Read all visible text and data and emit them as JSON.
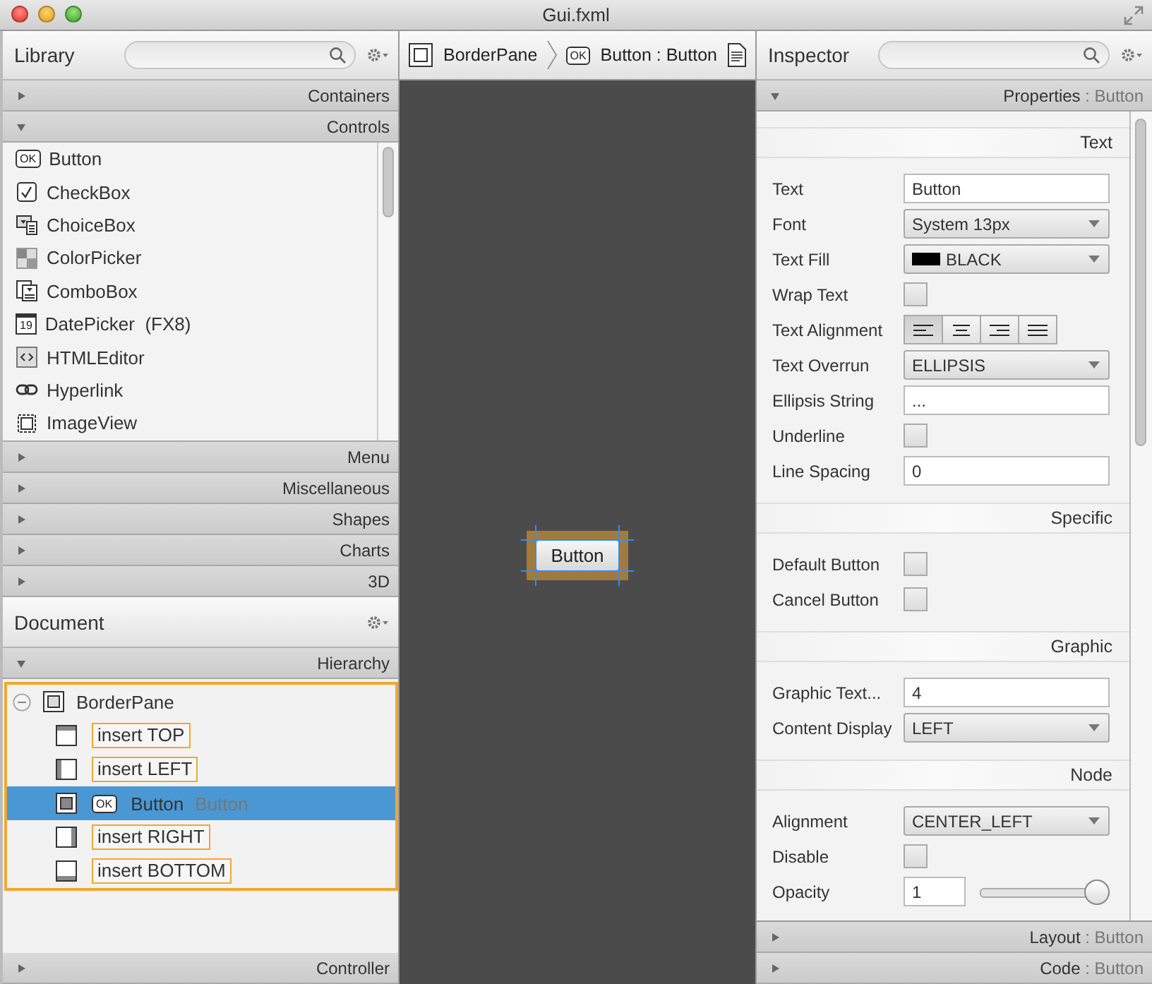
{
  "window": {
    "title": "Gui.fxml"
  },
  "library": {
    "title": "Library",
    "sections": [
      {
        "label": "Containers",
        "expanded": false
      },
      {
        "label": "Controls",
        "expanded": true,
        "items": [
          {
            "label": "Button",
            "badge": "OK"
          },
          {
            "label": "CheckBox"
          },
          {
            "label": "ChoiceBox"
          },
          {
            "label": "ColorPicker"
          },
          {
            "label": "ComboBox"
          },
          {
            "label": "DatePicker  (FX8)",
            "badge": "19"
          },
          {
            "label": "HTMLEditor"
          },
          {
            "label": "Hyperlink"
          },
          {
            "label": "ImageView"
          }
        ]
      },
      {
        "label": "Menu",
        "expanded": false
      },
      {
        "label": "Miscellaneous",
        "expanded": false
      },
      {
        "label": "Shapes",
        "expanded": false
      },
      {
        "label": "Charts",
        "expanded": false
      },
      {
        "label": "3D",
        "expanded": false
      }
    ]
  },
  "document": {
    "title": "Document",
    "sections": [
      {
        "label": "Hierarchy",
        "expanded": true,
        "tree": [
          {
            "label": "BorderPane",
            "expanded": true,
            "children": [
              {
                "kind": "slot",
                "label": "insert TOP",
                "selected": false
              },
              {
                "kind": "slot",
                "label": "insert LEFT",
                "selected": false
              },
              {
                "kind": "node",
                "badge": "OK",
                "label": "Button",
                "type": "Button",
                "selected": true
              },
              {
                "kind": "slot",
                "label": "insert RIGHT",
                "selected": false
              },
              {
                "kind": "slot",
                "label": "insert BOTTOM",
                "selected": false
              }
            ]
          }
        ]
      },
      {
        "label": "Controller",
        "expanded": false
      }
    ]
  },
  "breadcrumb": [
    {
      "label": "BorderPane"
    },
    {
      "label": "Button : Button",
      "badge": "OK"
    }
  ],
  "canvas": {
    "button": {
      "label": "Button",
      "selected": true
    }
  },
  "inspector": {
    "title": "Inspector",
    "sections": [
      {
        "label": "Properties",
        "context": ": Button",
        "expanded": true,
        "groups": [
          {
            "title": "Text",
            "rows": [
              {
                "kind": "text",
                "label": "Text",
                "value": "Button"
              },
              {
                "kind": "select",
                "label": "Font",
                "value": "System 13px"
              },
              {
                "kind": "color",
                "label": "Text Fill",
                "value": "BLACK",
                "color": "#000000"
              },
              {
                "kind": "checkbox",
                "label": "Wrap Text",
                "checked": false
              },
              {
                "kind": "segmented",
                "label": "Text Alignment",
                "options": [
                  {
                    "selected": true
                  },
                  {
                    "selected": false
                  },
                  {
                    "selected": false
                  },
                  {
                    "selected": false
                  }
                ]
              },
              {
                "kind": "select",
                "label": "Text Overrun",
                "value": "ELLIPSIS"
              },
              {
                "kind": "text",
                "label": "Ellipsis String",
                "value": "..."
              },
              {
                "kind": "checkbox",
                "label": "Underline",
                "checked": false
              },
              {
                "kind": "text",
                "label": "Line Spacing",
                "value": "0"
              }
            ]
          },
          {
            "title": "Specific",
            "rows": [
              {
                "kind": "checkbox",
                "label": "Default Button",
                "checked": false
              },
              {
                "kind": "checkbox",
                "label": "Cancel Button",
                "checked": false
              }
            ]
          },
          {
            "title": "Graphic",
            "rows": [
              {
                "kind": "text",
                "label": "Graphic Text...",
                "value": "4"
              },
              {
                "kind": "select",
                "label": "Content Display",
                "value": "LEFT"
              }
            ]
          },
          {
            "title": "Node",
            "rows": [
              {
                "kind": "select",
                "label": "Alignment",
                "value": "CENTER_LEFT"
              },
              {
                "kind": "checkbox",
                "label": "Disable",
                "checked": false
              },
              {
                "kind": "slider",
                "label": "Opacity",
                "value": "1",
                "level": 1
              }
            ]
          }
        ]
      },
      {
        "label": "Layout",
        "context": ": Button",
        "expanded": false
      },
      {
        "label": "Code",
        "context": ": Button",
        "expanded": false
      }
    ]
  }
}
